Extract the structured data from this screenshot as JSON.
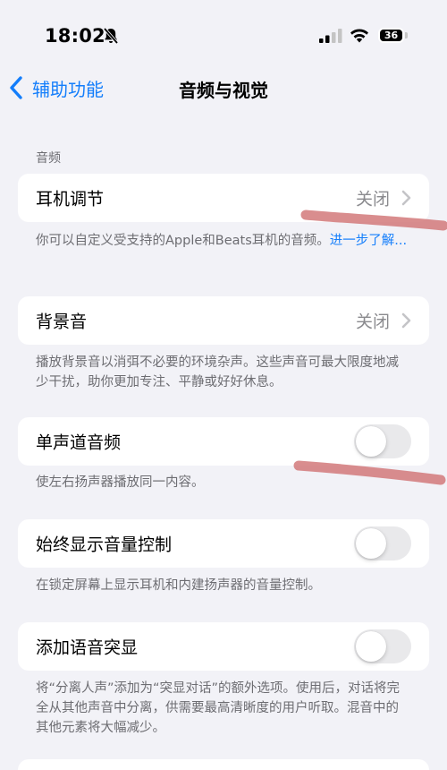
{
  "status_bar": {
    "time": "18:02",
    "battery": "36",
    "icons": [
      "bell-slash-icon",
      "cellular-signal-icon",
      "wifi-icon",
      "battery-icon"
    ]
  },
  "nav": {
    "back_label": "辅助功能",
    "title": "音频与视觉"
  },
  "section": {
    "header": "音频"
  },
  "rows": [
    {
      "label": "耳机调节",
      "value": "关闭",
      "footer": "你可以自定义受支持的Apple和Beats耳机的音频。",
      "footer_link": "进一步了解..."
    },
    {
      "label": "背景音",
      "value": "关闭",
      "footer": "播放背景音以消弭不必要的环境杂声。这些声音可最大限度地减少干扰，助你更加专注、平静或好好休息。"
    },
    {
      "label": "单声道音频",
      "toggle": false,
      "footer": "使左右扬声器播放同一内容。"
    },
    {
      "label": "始终显示音量控制",
      "toggle": false,
      "footer": "在锁定屏幕上显示耳机和内建扬声器的音量控制。"
    },
    {
      "label": "添加语音突显",
      "toggle": false,
      "footer": "将“分离人声”添加为“突显对话”的额外选项。使用后，对话将完全从其他声音中分离，供需要最高清晰度的用户听取。混音中的其他元素将大幅减少。"
    }
  ],
  "colors": {
    "background": "#f2f2f7",
    "accent": "#147efb",
    "secondary_text": "#6d6d72",
    "toggle_off": "#e9e9eb",
    "annotation": "#d2797a"
  }
}
